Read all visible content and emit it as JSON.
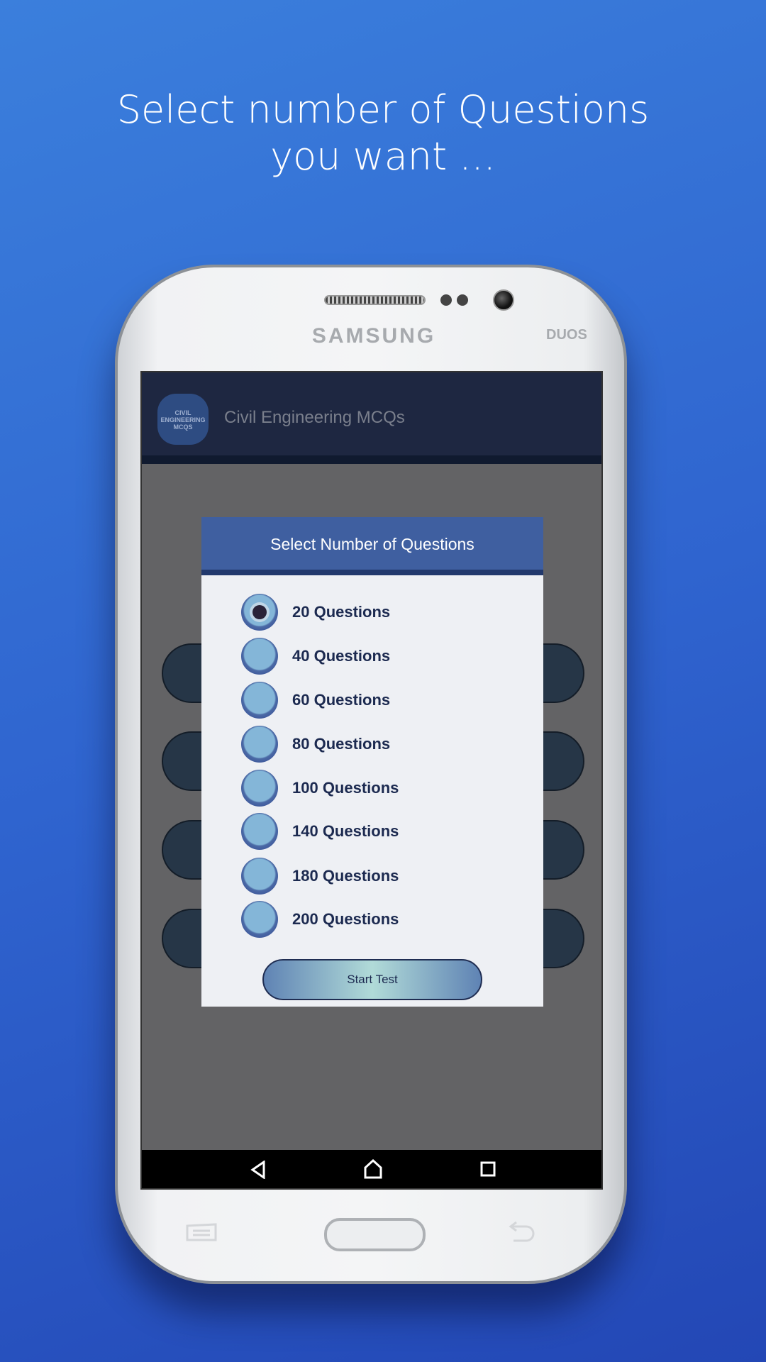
{
  "headline": {
    "line1": "Select number of Questions",
    "line2": "you want ..."
  },
  "device": {
    "brand": "SAMSUNG",
    "model_badge": "DUOS"
  },
  "app": {
    "title": "Civil Engineering MCQs",
    "logo_text": "CIVIL ENGINEERING MCQS"
  },
  "dialog": {
    "title": "Select Number of Questions",
    "options": [
      {
        "label": "20  Questions",
        "selected": true
      },
      {
        "label": "40  Questions",
        "selected": false
      },
      {
        "label": "60  Questions",
        "selected": false
      },
      {
        "label": "80  Questions",
        "selected": false
      },
      {
        "label": "100 Questions",
        "selected": false
      },
      {
        "label": "140 Questions",
        "selected": false
      },
      {
        "label": "180 Questions",
        "selected": false
      },
      {
        "label": "200 Questions",
        "selected": false
      }
    ],
    "start_label": "Start Test"
  },
  "nav": {
    "back": "◁",
    "home": "⌂",
    "recents": "□"
  },
  "colors": {
    "background": "#2f64cf",
    "dialog_header": "#3f5fa0",
    "app_bar": "#1e2741"
  }
}
